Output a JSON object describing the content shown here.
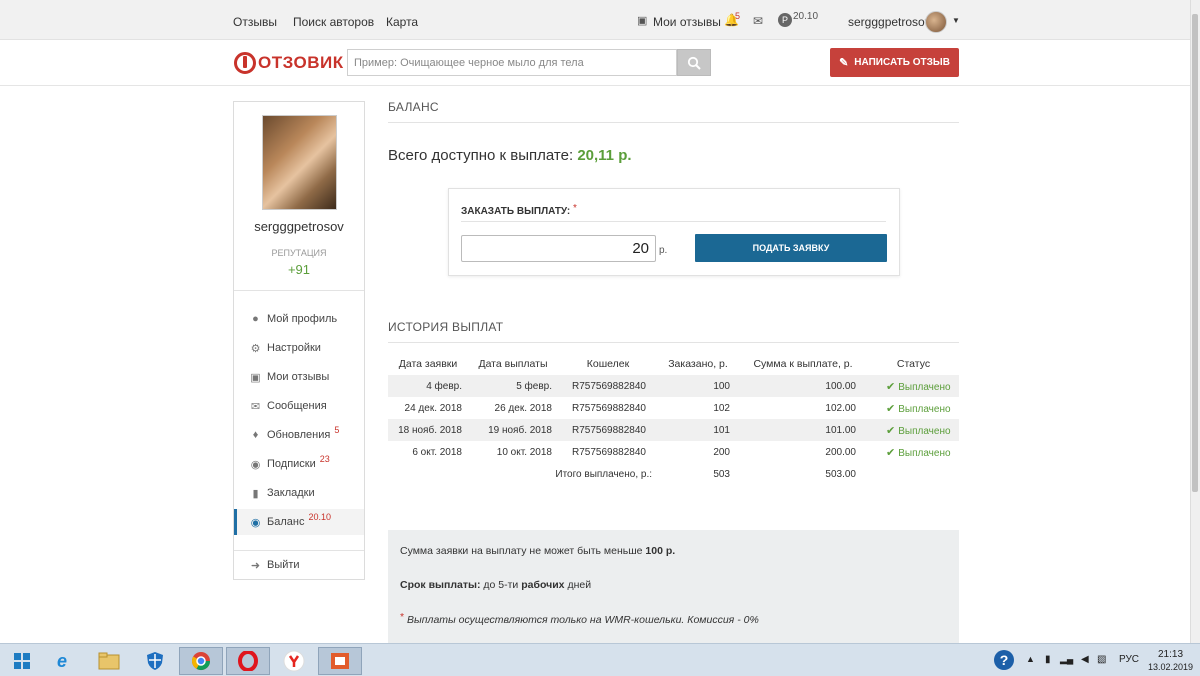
{
  "topbar": {
    "nav": [
      "Отзывы",
      "Поиск авторов",
      "Карта"
    ],
    "my_reviews": "Мои отзывы",
    "notifications_count": "5",
    "balance": "20.10",
    "username": "sergggpetrosov"
  },
  "header": {
    "logo_text": "ОТЗОВИК",
    "search_placeholder": "Пример: Очищающее черное мыло для тела",
    "write_button": "НАПИСАТЬ ОТЗЫВ"
  },
  "sidebar": {
    "username": "sergggpetrosov",
    "reputation_label": "РЕПУТАЦИЯ",
    "reputation_value": "+91",
    "items": [
      {
        "label": "Мой профиль",
        "icon": "user-icon",
        "badge": ""
      },
      {
        "label": "Настройки",
        "icon": "gear-icon",
        "badge": ""
      },
      {
        "label": "Мои отзывы",
        "icon": "comment-icon",
        "badge": ""
      },
      {
        "label": "Сообщения",
        "icon": "envelope-icon",
        "badge": ""
      },
      {
        "label": "Обновления",
        "icon": "bell-icon",
        "badge": "5"
      },
      {
        "label": "Подписки",
        "icon": "users-icon",
        "badge": "23"
      },
      {
        "label": "Закладки",
        "icon": "bookmark-icon",
        "badge": ""
      },
      {
        "label": "Баланс",
        "icon": "wallet-icon",
        "badge": "20.10"
      }
    ],
    "active_item": "Баланс",
    "logout": "Выйти"
  },
  "main": {
    "balance_title": "БАЛАНС",
    "available_label": "Всего доступно к выплате:",
    "available_amount": "20,11 р.",
    "order": {
      "label": "ЗАКАЗАТЬ ВЫПЛАТУ:",
      "required_mark": "*",
      "amount_value": "20",
      "currency": "р.",
      "submit": "ПОДАТЬ ЗАЯВКУ"
    },
    "history_title": "ИСТОРИЯ ВЫПЛАТ",
    "history_columns": [
      "Дата заявки",
      "Дата выплаты",
      "Кошелек",
      "Заказано, р.",
      "Сумма к выплате, р.",
      "Статус"
    ],
    "history_rows": [
      {
        "request_date": "4 февр.",
        "pay_date": "5 февр.",
        "wallet": "R757569882840",
        "ordered": "100",
        "amount": "100.00",
        "status": "Выплачено"
      },
      {
        "request_date": "24 дек. 2018",
        "pay_date": "26 дек. 2018",
        "wallet": "R757569882840",
        "ordered": "102",
        "amount": "102.00",
        "status": "Выплачено"
      },
      {
        "request_date": "18 нояб. 2018",
        "pay_date": "19 нояб. 2018",
        "wallet": "R757569882840",
        "ordered": "101",
        "amount": "101.00",
        "status": "Выплачено"
      },
      {
        "request_date": "6 окт. 2018",
        "pay_date": "10 окт. 2018",
        "wallet": "R757569882840",
        "ordered": "200",
        "amount": "200.00",
        "status": "Выплачено"
      }
    ],
    "total_label": "Итого выплачено, р.:",
    "total_ordered": "503",
    "total_amount": "503.00",
    "info": {
      "min_text": "Сумма заявки на выплату не может быть меньше",
      "min_value": "100 р.",
      "term_label": "Срок выплаты:",
      "term_text": "до 5-ти",
      "term_bold": "рабочих",
      "term_end": "дней",
      "note_mark": "*",
      "note_text": "Выплаты осуществляются только на WMR-кошельки. Комиссия - 0%"
    }
  },
  "taskbar": {
    "lang": "РУС",
    "time": "21:13",
    "date": "13.02.2019"
  },
  "colors": {
    "accent_green": "#5b9e3a",
    "brand_red": "#c8332b",
    "button_blue": "#1b6894"
  }
}
